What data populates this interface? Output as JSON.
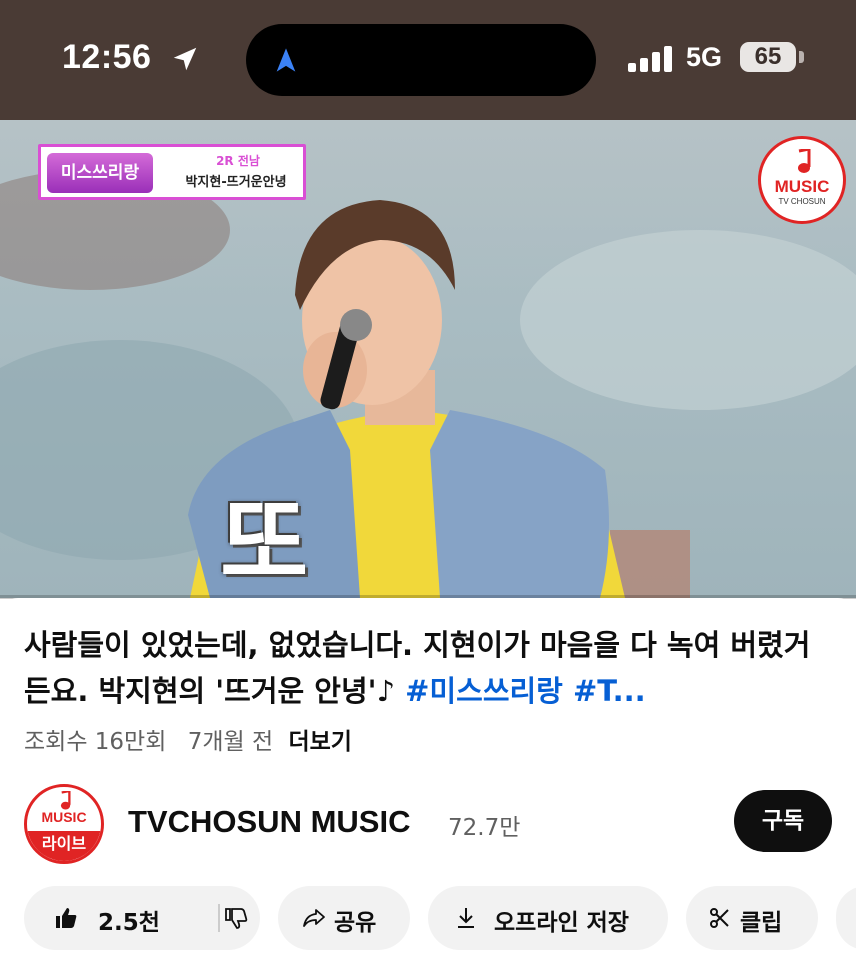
{
  "status_bar": {
    "time": "12:56",
    "network": "5G",
    "battery": "65"
  },
  "video": {
    "show_logo_text": "미스쓰리랑",
    "banner_round": "2R 전남",
    "banner_song": "박지현-뜨거운안녕",
    "channel_logo_text": "MUSIC",
    "channel_logo_sub": "TV CHOSUN",
    "caption_glyph": "또",
    "progress": 0.0
  },
  "info": {
    "title_text": "사람들이 있었는데, 없었습니다. 지현이가 마음을 다 녹여 버렸거든요. 박지현의 '뜨거운 안녕'♪ ",
    "title_tags": "#미스쓰리랑 #T...",
    "views": "조회수 16만회",
    "age": "7개월 전",
    "more": "더보기"
  },
  "channel": {
    "avatar_top": "MUSIC",
    "avatar_bottom": "라이브",
    "name": "TVCHOSUN MUSIC",
    "subscribers": "72.7만",
    "subscribe_label": "구독"
  },
  "actions": {
    "likes": "2.5천",
    "share": "공유",
    "download": "오프라인 저장",
    "clip": "클립"
  },
  "colors": {
    "status_bg": "#4a3b35",
    "hashtag": "#065fd4",
    "brand_red": "#e02424",
    "show_magenta": "#d94fd4"
  }
}
